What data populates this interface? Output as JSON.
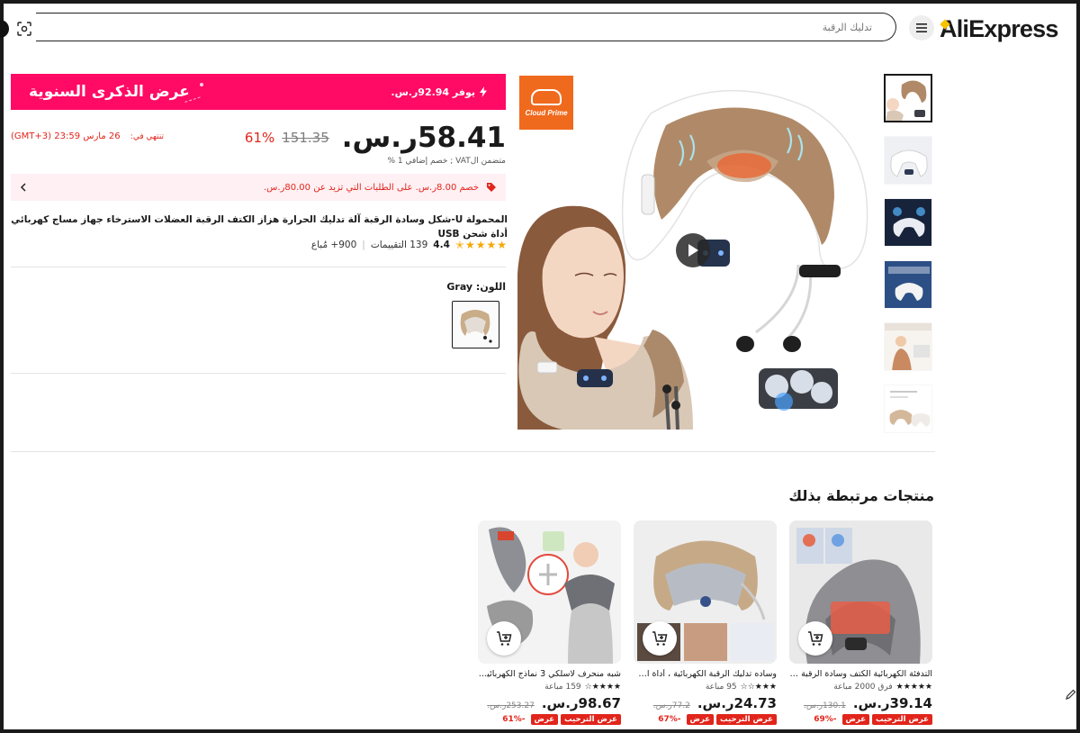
{
  "header": {
    "logo": "AliExpress",
    "search_placeholder": "تدليك الرقبة"
  },
  "promo": {
    "title": "عرض الذكرى السنوية",
    "save_text": "يوفر 92.94ر.س."
  },
  "price": {
    "current": "58.41ر.س.",
    "original": "151.35",
    "discount": "61%",
    "ends_label": "تنتهي في:",
    "ends_time": "26 مارس 23:59 (GMT+3)",
    "vat_note": "متضمن الVAT ; خصم إضافي 1 %"
  },
  "coupon": {
    "text": "خصم 8.00ر.س. على الطلبات التي تزيد عن 80.00ر.س."
  },
  "product": {
    "title": "المحمولة U-شكل وسادة الرقبة آلة تدليك الحرارة هزاز الكتف الرقبة العضلات الاسترخاء جهاز مساج كهربائي أداة شحن USB",
    "rating": "4.4",
    "reviews": "139 التقييمات",
    "sold": "900+ مُباع",
    "color_label": "اللون: Gray",
    "brand_badge": "Cloud Prime"
  },
  "related": {
    "title": "منتجات مرتبطة بذلك",
    "items": [
      {
        "title": "التدفئة الكهربائية الكتف وسادة الرقبة منظ...",
        "meta": "فرق 2000 مباعة",
        "price": "39.14ر.س.",
        "old_price": "130.1ر.س.",
        "tag1": "عرض الترحيب",
        "tag2": "عرض",
        "discount": "-69%"
      },
      {
        "title": "وساده تدليك الرقبة الكهربائية ، أداة الاستر...",
        "meta": "95 مباعة",
        "price": "24.73ر.س.",
        "old_price": "77.2ر.س.",
        "tag1": "عرض الترحيب",
        "tag2": "عرض",
        "discount": "-67%"
      },
      {
        "title": "شبه منحرف لاسلكي 3 نماذج الكهربائية للك...",
        "meta": "159 مباعة",
        "price": "98.67ر.س.",
        "old_price": "253.27ر.س.",
        "tag1": "عرض الترحيب",
        "tag2": "عرض",
        "discount": "-61%"
      }
    ]
  },
  "colors": {
    "accent": "#ff0a64",
    "price_red": "#e1251b",
    "brand_orange": "#f06a1e"
  }
}
